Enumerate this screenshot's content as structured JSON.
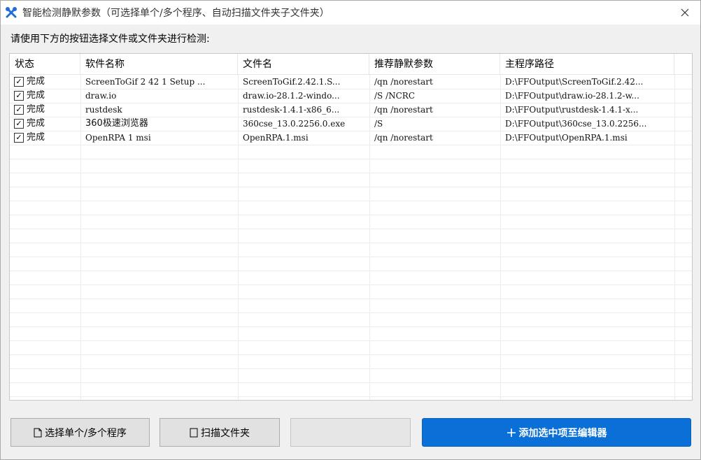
{
  "window": {
    "title": "智能检测静默参数（可选择单个/多个程序、自动扫描文件夹子文件夹）",
    "accent_color": "#0a6fd6"
  },
  "instruction": "请使用下方的按钮选择文件或文件夹进行检测:",
  "table": {
    "columns": [
      "状态",
      "软件名称",
      "文件名",
      "推荐静默参数",
      "主程序路径"
    ],
    "rows": [
      {
        "checked": true,
        "status": "完成",
        "name": "ScreenToGif 2 42 1 Setup ...",
        "file": "ScreenToGif.2.42.1.S...",
        "params": "/qn /norestart",
        "path": "D:\\FFOutput\\ScreenToGif.2.42..."
      },
      {
        "checked": true,
        "status": "完成",
        "name": "draw.io",
        "file": "draw.io-28.1.2-windo...",
        "params": "/S /NCRC",
        "path": "D:\\FFOutput\\draw.io-28.1.2-w..."
      },
      {
        "checked": true,
        "status": "完成",
        "name": "rustdesk",
        "file": "rustdesk-1.4.1-x86_6...",
        "params": "/qn /norestart",
        "path": "D:\\FFOutput\\rustdesk-1.4.1-x..."
      },
      {
        "checked": true,
        "status": "完成",
        "name": "360极速浏览器",
        "file": "360cse_13.0.2256.0.exe",
        "params": "/S",
        "path": "D:\\FFOutput\\360cse_13.0.2256..."
      },
      {
        "checked": true,
        "status": "完成",
        "name": "OpenRPA 1 msi",
        "file": "OpenRPA.1.msi",
        "params": "/qn /norestart",
        "path": "D:\\FFOutput\\OpenRPA.1.msi"
      }
    ]
  },
  "buttons": {
    "select_programs": "选择单个/多个程序",
    "scan_folder": "扫描文件夹",
    "blank": "",
    "add_to_editor": "添加选中项至编辑器"
  }
}
